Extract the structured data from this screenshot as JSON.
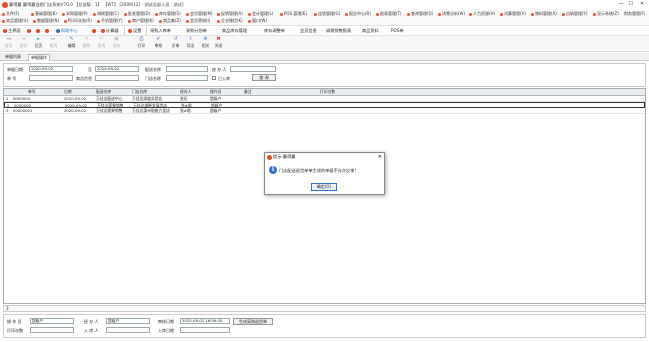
{
  "window": {
    "title": "赢得赢 赢得赢连锁门店系统V70.0 【总部版 : 1】 【WT】 [2009/12] - 测试总部人员 : 测试]",
    "controls": [
      "—",
      "☐",
      "✕"
    ]
  },
  "menu": {
    "row1": [
      "文件(F)",
      "基础管理(B)",
      "采购管理(P)",
      "调拨管理(C)",
      "批发管理(D)",
      "库存管理(S)",
      "会员管理(M)",
      "促销管理(A)",
      "会计管理(L)",
      "POS 管理(E)",
      "连锁管理(G)",
      "报告中心(R)",
      "报表管理(T)",
      "查询管理(Q)",
      "决策分析(W)",
      "人力资源(H)",
      "试算管理(V)",
      "物料管理(X)",
      "出纳管理(Y)",
      "显示系统(Z)",
      "财务管理(F)"
    ],
    "row2": [
      "商品管理(U)",
      "数据管理(N)",
      "PLUS业务(R)",
      "手机管理(Y)",
      "商户管理(K)",
      "商品集(Z)",
      "会员营销(I)",
      "企业微信(K)",
      "窗口(W)"
    ]
  },
  "nav": {
    "items": [
      {
        "label": "主界面",
        "color": "#e54b2a"
      },
      {
        "label": "",
        "color": "#e54b2a"
      },
      {
        "label": "",
        "color": "#e54b2a"
      },
      {
        "label": "",
        "color": "#e54b2a"
      },
      {
        "label": "帮助中心",
        "color": "#2e6fd1"
      },
      {
        "label": "",
        "color": "#e54b2a"
      },
      {
        "label": "计算器",
        "color": "#e54b2a"
      },
      {
        "label": "设置",
        "color": "#e54b2a"
      },
      {
        "label": "采购入库单",
        "color": ""
      },
      {
        "label": "采购计划单",
        "color": ""
      },
      {
        "label": "商品库存管理",
        "color": ""
      },
      {
        "label": "库存调整单",
        "color": ""
      },
      {
        "label": "会员信息",
        "color": ""
      },
      {
        "label": "调拨销售报表",
        "color": ""
      },
      {
        "label": "商品资料",
        "color": ""
      },
      {
        "label": "POS单",
        "color": ""
      }
    ]
  },
  "toolbar": {
    "buttons": [
      {
        "label": "首页",
        "icon": "◂◂",
        "enabled": false
      },
      {
        "label": "前页",
        "icon": "◂",
        "enabled": false
      },
      {
        "label": "后页",
        "icon": "▸",
        "enabled": true
      },
      {
        "label": "尾页",
        "icon": "▸▸",
        "enabled": false
      },
      {
        "label": "编辑",
        "icon": "✎",
        "enabled": true
      },
      {
        "label": "删除",
        "icon": "✕",
        "enabled": false
      },
      {
        "label": "取消",
        "icon": "↶",
        "enabled": false
      },
      {
        "label": "保存",
        "icon": "▣",
        "enabled": false
      },
      {
        "label": "打印",
        "icon": "⎙",
        "enabled": true
      },
      {
        "label": "审核",
        "icon": "✔",
        "enabled": true
      },
      {
        "label": "反审",
        "icon": "↺",
        "enabled": true
      },
      {
        "label": "导出",
        "icon": "⇪",
        "enabled": true
      },
      {
        "label": "相关",
        "icon": "⚙",
        "enabled": true
      },
      {
        "label": "关闭",
        "icon": "✖",
        "enabled": true
      }
    ],
    "report_label": "报表选择：",
    "report_value": "测试退货入库"
  },
  "tabs": [
    {
      "label": "单据列表",
      "active": false
    },
    {
      "label": "单据操作",
      "active": true
    }
  ],
  "filter": {
    "date_start_label": "单据日期",
    "date_start": "2020-09-02",
    "to_label": "至",
    "date_end": "2020-09-02",
    "warehouse_label": "配送仓库",
    "warehouse": "",
    "handler_label": "经 办 人",
    "handler": "",
    "doc_no_label": "单 号",
    "doc_no": "",
    "goods_label": "商品信息",
    "goods": "",
    "store_label": "门店名称",
    "store": "",
    "stored_label": "已入库",
    "query_btn": "查 询"
  },
  "grid": {
    "columns": [
      "",
      "单号",
      "日期",
      "配送仓库",
      "门店仓库",
      "经办人",
      "操作员",
      "备注",
      "打印次数"
    ],
    "rows": [
      {
        "idx": "1",
        "cells": [
          "0000004",
          "2020-09-02",
          "万佳达配送中心",
          "万佳达测量实验店",
          "张伍",
          "超级户",
          "",
          ""
        ],
        "selected": false
      },
      {
        "idx": "2",
        "cells": [
          "0000005",
          "2020-09-02",
          "万佳达蔬果销售",
          "万佳达湖畔发展华店",
          "张#晗",
          "超级户",
          "",
          ""
        ],
        "selected": true
      },
      {
        "idx": "3",
        "cells": [
          "00000001",
          "2020-09-02",
          "万佳达蔬果销售",
          "万佳达惠州银座九龙店",
          "张#晗",
          "超级户",
          "",
          ""
        ],
        "selected": false
      }
    ]
  },
  "status": {
    "count": "3"
  },
  "footer": {
    "operator_label": "操 作 员",
    "operator": "超级户",
    "handler_label": "经 办 人",
    "handler": "超级户",
    "audit_date_label": "审核日期",
    "audit_date": "2020-09-02 16:59:00",
    "generate_btn": "生成采购退货单",
    "print_count_label": "打印次数",
    "print_count": "",
    "warehouse_in_label": "入 库 人",
    "warehouse_in": "",
    "in_date_label": "入库日期",
    "in_date": ""
  },
  "dialog": {
    "title": "提示-赢得赢",
    "message": "门店配送退货单单生成的单据不允许反审!",
    "ok": "确定(O)",
    "close": "✕"
  }
}
